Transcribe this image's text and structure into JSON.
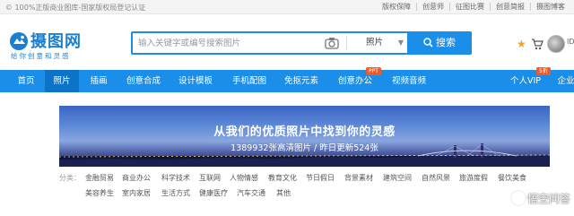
{
  "topbar": {
    "notice": "© 100%正版商业图库-国家版权局登记认证",
    "links": [
      "版权保障",
      "创意师",
      "征图比赛",
      "创意简报",
      "摄图博客"
    ]
  },
  "logo": {
    "title": "摄图网",
    "slogan": "给你创意和灵感"
  },
  "search": {
    "placeholder": "输入关键字或编号搜索图片",
    "type": "照片",
    "button": "搜索"
  },
  "user": {
    "id": "ID"
  },
  "nav": {
    "items": [
      {
        "label": "首页"
      },
      {
        "label": "照片"
      },
      {
        "label": "插画"
      },
      {
        "label": "创意合成"
      },
      {
        "label": "设计模板"
      },
      {
        "label": "手机配图"
      },
      {
        "label": "免抠元素"
      },
      {
        "label": "创意办公",
        "badge": "PPT"
      },
      {
        "label": "视频音频"
      },
      {
        "label": "个人VIP",
        "badge": "5折"
      },
      {
        "label": "企业"
      }
    ]
  },
  "banner": {
    "title": "从我们的优质照片中找到你的灵感",
    "subtitle": "1389932张高清图片 / 昨日更新524张"
  },
  "categories": {
    "label": "分类：",
    "items": [
      "金融贸易",
      "商业办公",
      "科学技术",
      "互联网",
      "人物情感",
      "教育文化",
      "节日假日",
      "背景素材",
      "建筑空间",
      "自然风景",
      "旅游度假",
      "餐饮美食",
      "美容养生",
      "室内家居",
      "生活方式",
      "健康医疗",
      "汽车交通",
      "其他"
    ]
  },
  "watermark": "悟空问答",
  "colors": {
    "brand": "#1a8ee8",
    "nav_active": "#0c73c8",
    "badge": "#f05a28",
    "star": "#f3a324"
  }
}
